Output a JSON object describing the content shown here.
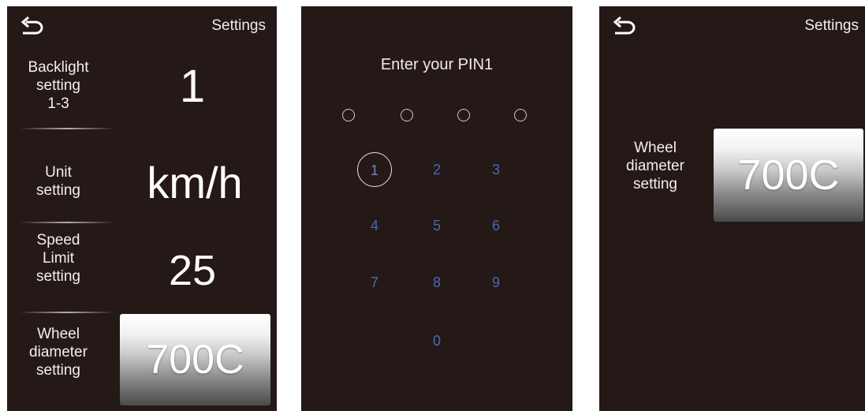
{
  "left_screen": {
    "settings_title": "Settings",
    "back_icon": "back-arrow-icon",
    "backlight": {
      "label_line1": "Backlight",
      "label_line2": "setting",
      "label_line3": "1-3",
      "value": "1"
    },
    "unit": {
      "label_line1": "Unit",
      "label_line2": "setting",
      "value": "km/h"
    },
    "speed_limit": {
      "label_line1": "Speed",
      "label_line2": "Limit",
      "label_line3": "setting",
      "value": "25"
    },
    "wheel": {
      "label_line1": "Wheel",
      "label_line2": "diameter",
      "label_line3": "setting",
      "value": "700C"
    }
  },
  "pin_screen": {
    "title": "Enter your PIN1",
    "keys": [
      "1",
      "2",
      "3",
      "4",
      "5",
      "6",
      "7",
      "8",
      "9",
      "0"
    ],
    "pressed_key": "1",
    "key_color": "#4a68b6",
    "entered_count": 0,
    "total_digits": 4
  },
  "right_screen": {
    "settings_title": "Settings",
    "back_icon": "back-arrow-icon",
    "wheel": {
      "label_line1": "Wheel",
      "label_line2": "diameter",
      "label_line3": "setting",
      "value": "700C"
    }
  },
  "colors": {
    "screen_bg": "#241916",
    "text": "#ffffff",
    "keypad_digits": "#4a68b6"
  }
}
